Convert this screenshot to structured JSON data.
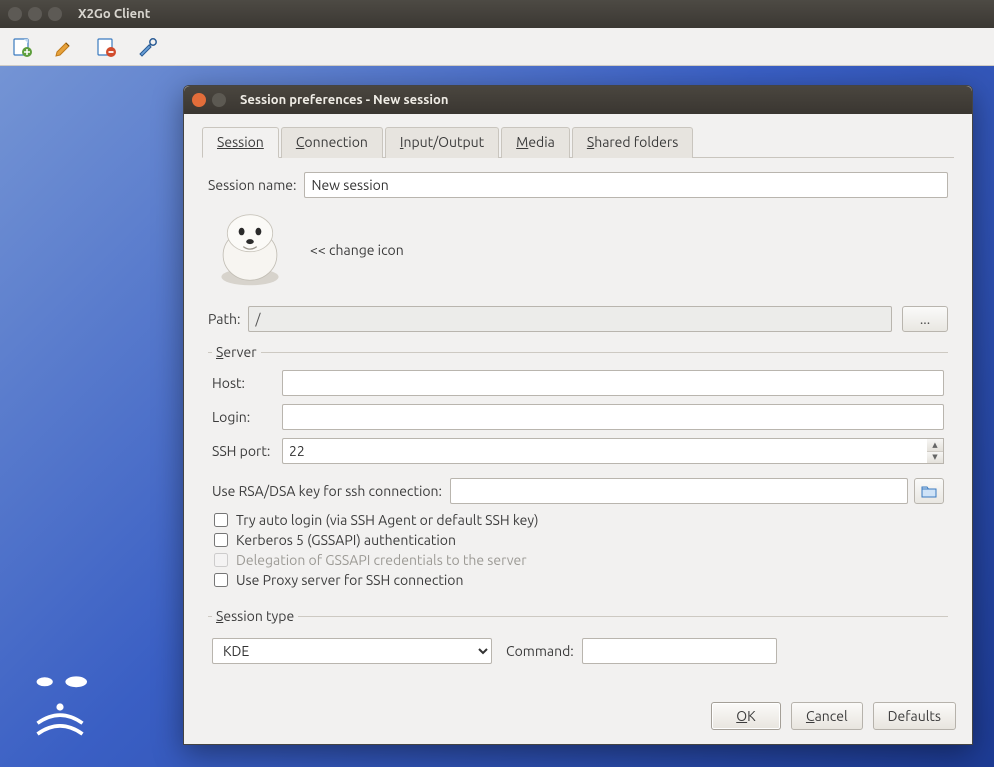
{
  "main_window": {
    "title": "X2Go Client"
  },
  "dialog": {
    "title": "Session preferences - New session",
    "tabs": [
      "Session",
      "Connection",
      "Input/Output",
      "Media",
      "Shared folders"
    ],
    "active_tab": 0,
    "session_name_label": "Session name:",
    "session_name_value": "New session",
    "change_icon_text": "<< change icon",
    "path_label": "Path:",
    "path_value": "/",
    "browse_label": "...",
    "server": {
      "legend": "Server",
      "host_label": "Host:",
      "host_value": "",
      "login_label": "Login:",
      "login_value": "",
      "sshport_label": "SSH port:",
      "sshport_value": "22",
      "key_label": "Use RSA/DSA key for ssh connection:",
      "key_value": "",
      "chk_autologin": "Try auto login (via SSH Agent or default SSH key)",
      "chk_kerberos": "Kerberos 5 (GSSAPI) authentication",
      "chk_delegation": "Delegation of GSSAPI credentials to the server",
      "chk_proxy": "Use Proxy server for SSH connection"
    },
    "session_type": {
      "legend": "Session type",
      "value": "KDE",
      "command_label": "Command:",
      "command_value": ""
    },
    "buttons": {
      "ok": "OK",
      "cancel": "Cancel",
      "defaults": "Defaults"
    }
  }
}
